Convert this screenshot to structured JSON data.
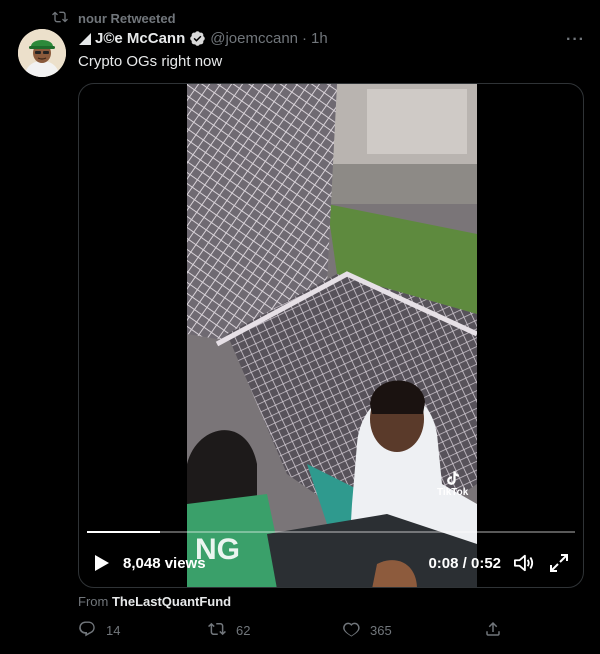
{
  "retweet": {
    "label": "nour Retweeted",
    "icon": "retweet-icon"
  },
  "tweet": {
    "display_name": "J©e McCann",
    "handle": "@joemccann",
    "separator": "·",
    "time": "1h",
    "text": "Crypto OGs right now",
    "more_label": "···"
  },
  "video": {
    "views": "8,048 views",
    "time_display": "0:08 / 0:52",
    "progress_fraction": 0.15,
    "watermark": "TikTok"
  },
  "source": {
    "prefix": "From",
    "name": "TheLastQuantFund"
  },
  "actions": {
    "reply_count": "14",
    "retweet_count": "62",
    "like_count": "365"
  },
  "colors": {
    "verified": "#d9d9d9",
    "muted": "#71767b",
    "text": "#e7e9ea",
    "background": "#000000"
  }
}
